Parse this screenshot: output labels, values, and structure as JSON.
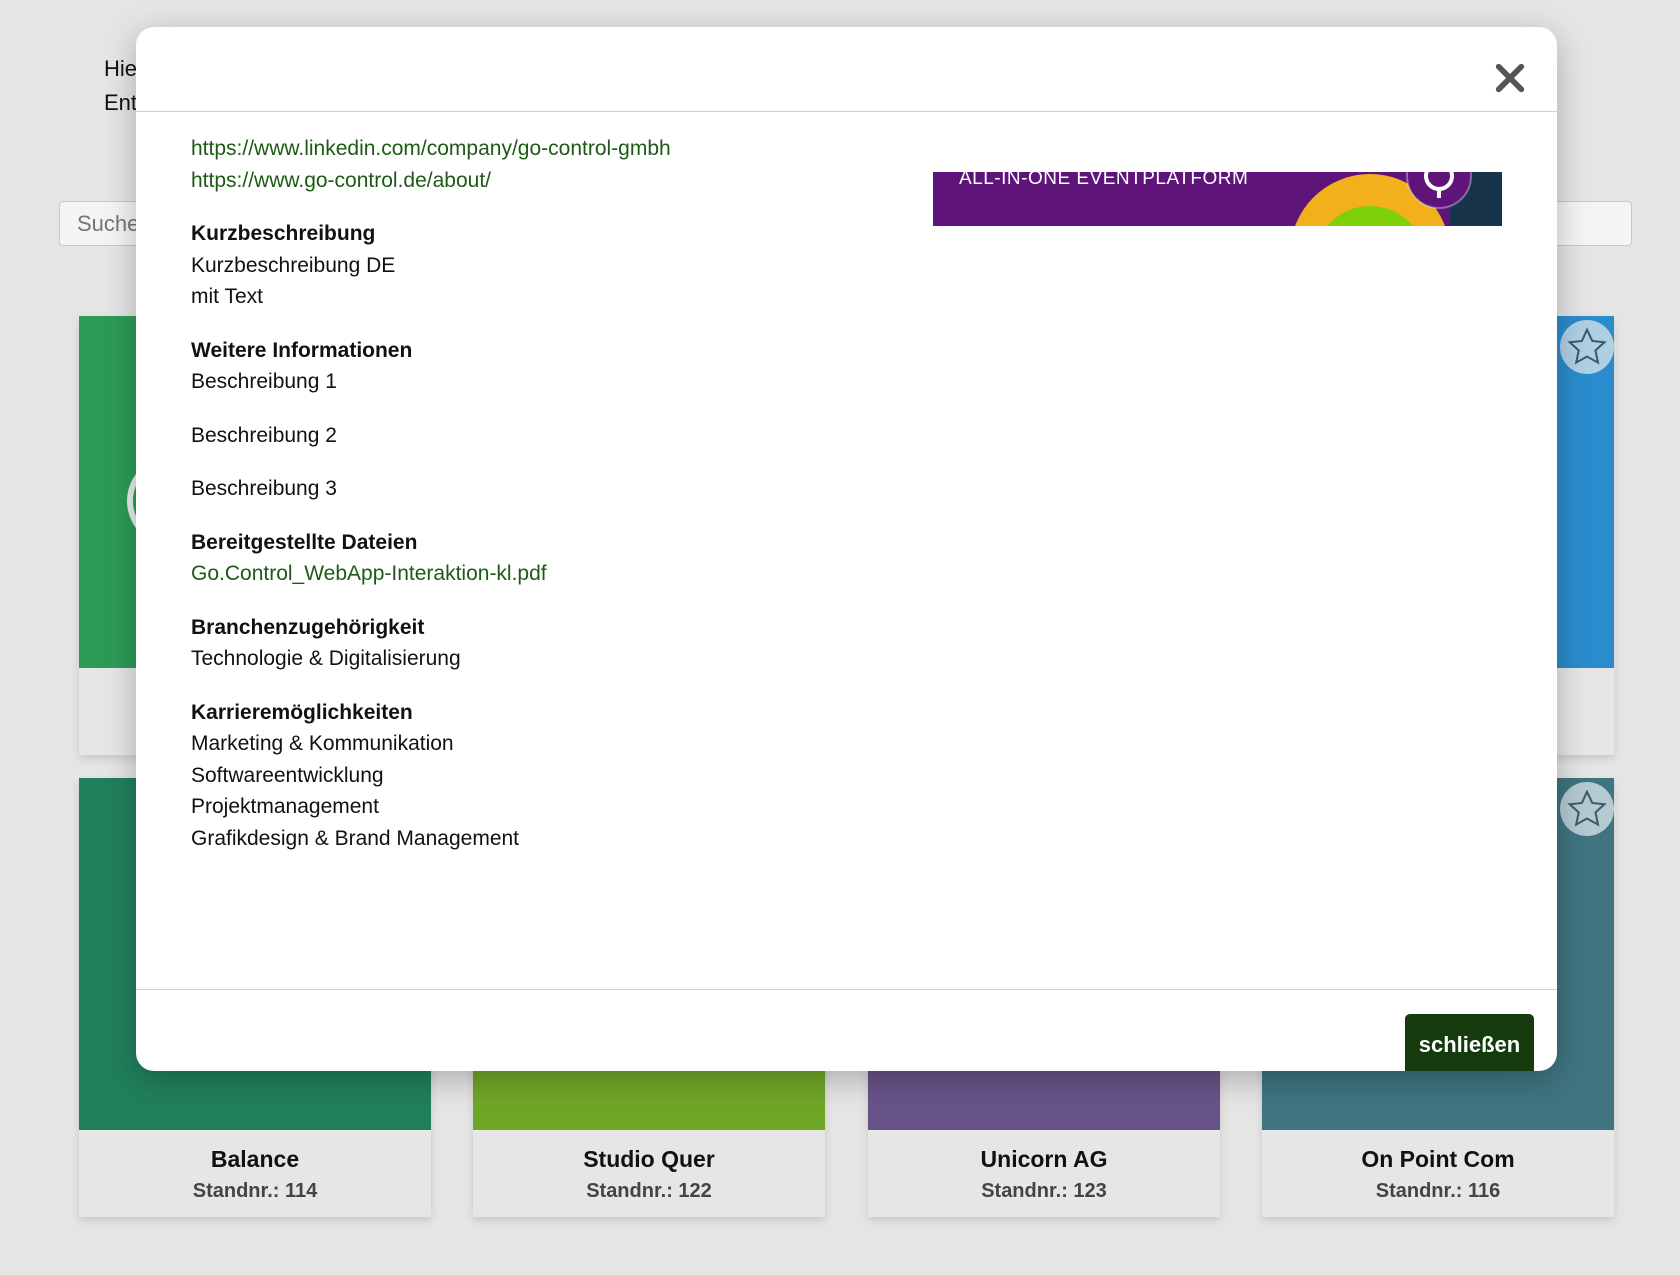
{
  "background": {
    "intro_line1": "Hie",
    "intro_line2": "Ent",
    "search_placeholder": "Suche",
    "cards_top_row": [
      {
        "color": "#2c9b57",
        "art_color": "#2c9b57"
      },
      {
        "color": "#2a8ccc",
        "art_color": "#2a8ccc"
      }
    ],
    "cards_bottom_row": [
      {
        "name": "Balance",
        "stand": "Standnr.: 114",
        "color": "#217f5c"
      },
      {
        "name": "Studio Quer",
        "stand": "Standnr.: 122",
        "color": "#70a626"
      },
      {
        "name": "Unicorn AG",
        "stand": "Standnr.: 123",
        "color": "#675387"
      },
      {
        "name": "On Point Com",
        "stand": "Standnr.: 116",
        "color": "#3f7480"
      }
    ]
  },
  "modal": {
    "links": [
      "https://www.linkedin.com/company/go-control-gmbh",
      "https://www.go-control.de/about/"
    ],
    "sections": {
      "kurz": {
        "title": "Kurzbeschreibung",
        "lines": [
          "Kurzbeschreibung DE",
          "mit Text"
        ]
      },
      "weitere": {
        "title": "Weitere Informationen",
        "lines": [
          "Beschreibung 1",
          "Beschreibung 2",
          "Beschreibung 3"
        ]
      },
      "dateien": {
        "title": "Bereitgestellte Dateien",
        "file": "Go.Control_WebApp-Interaktion-kl.pdf"
      },
      "branche": {
        "title": "Branchenzugehörigkeit",
        "lines": [
          "Technologie & Digitalisierung"
        ]
      },
      "karriere": {
        "title": "Karrieremöglichkeiten",
        "lines": [
          "Marketing & Kommunikation",
          "Softwareentwicklung",
          "Projektmanagement",
          "Grafikdesign & Brand Management"
        ]
      }
    },
    "banner_text": "ALL-IN-ONE EVENTPLATFORM",
    "close_button_label": "schließen",
    "colors": {
      "link": "#1e5a16",
      "button": "#143a0e",
      "banner": "#5e1479"
    }
  }
}
